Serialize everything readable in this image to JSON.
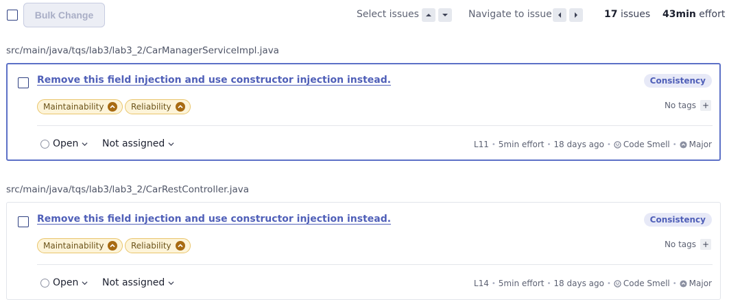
{
  "toolbar": {
    "bulk_change_label": "Bulk Change",
    "select_issues_label": "Select issues",
    "navigate_label": "Navigate to issue",
    "issues_count": "17",
    "issues_word": "issues",
    "effort_value": "43min",
    "effort_word": "effort"
  },
  "issues": [
    {
      "file_path": "src/main/java/tqs/lab3/lab3_2/CarManagerServiceImpl.java",
      "title": "Remove this field injection and use constructor injection instead.",
      "attribute": "Consistency",
      "impacts": [
        "Maintainability",
        "Reliability"
      ],
      "tags": "No tags",
      "status": "Open",
      "assignee": "Not assigned",
      "line": "L11",
      "effort": "5min effort",
      "age": "18 days ago",
      "type": "Code Smell",
      "severity": "Major",
      "selected": true
    },
    {
      "file_path": "src/main/java/tqs/lab3/lab3_2/CarRestController.java",
      "title": "Remove this field injection and use constructor injection instead.",
      "attribute": "Consistency",
      "impacts": [
        "Maintainability",
        "Reliability"
      ],
      "tags": "No tags",
      "status": "Open",
      "assignee": "Not assigned",
      "line": "L14",
      "effort": "5min effort",
      "age": "18 days ago",
      "type": "Code Smell",
      "severity": "Major",
      "selected": false
    }
  ],
  "colors": {
    "accent": "#5b6fc6",
    "link": "#4f5fb8",
    "impact_bg": "#fdf4d9",
    "impact_border": "#e9c46a",
    "impact_icon": "#a86b12"
  },
  "icons": {
    "arrow_up": "caret-up-icon",
    "arrow_down": "caret-down-icon",
    "arrow_left": "caret-left-icon",
    "arrow_right": "caret-right-icon",
    "impact": "severity-medium-icon",
    "status": "status-circle-icon",
    "chevron": "chevron-down-icon",
    "type": "code-smell-icon",
    "severity": "severity-major-icon"
  }
}
